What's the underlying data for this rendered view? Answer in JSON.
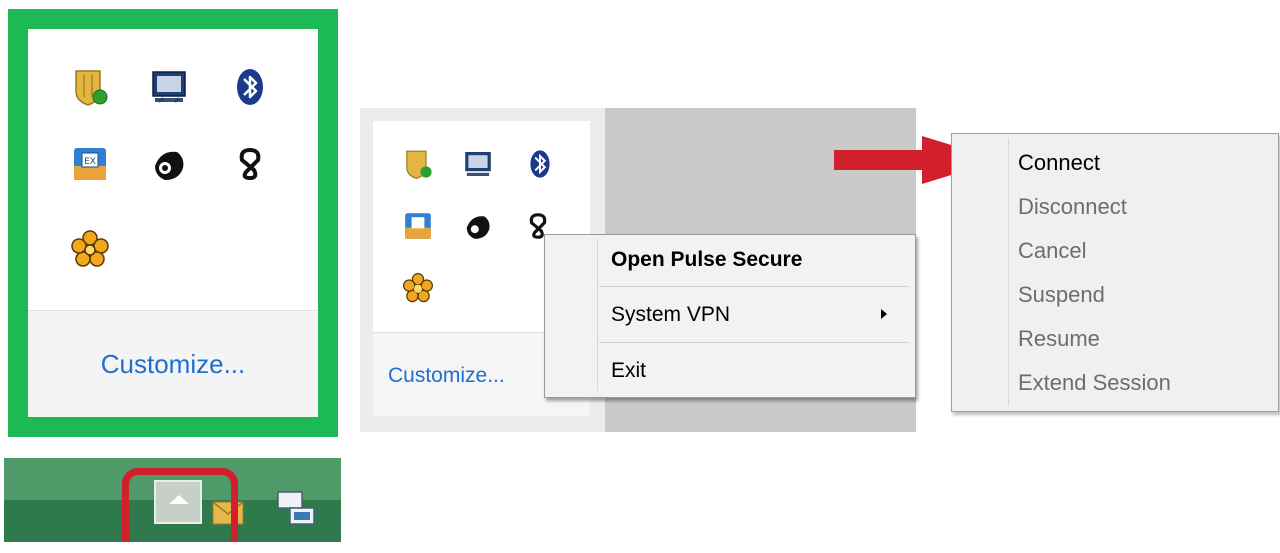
{
  "tray_panel": {
    "customize_label": "Customize...",
    "icons": [
      "shield-status-icon",
      "display-icon",
      "bluetooth-icon",
      "ime-icon",
      "ninja-icon",
      "pulse-secure-icon",
      "flower-icon"
    ]
  },
  "taskbar": {
    "show_hidden_icons_button": "show-hidden-icons-button"
  },
  "context_menu": {
    "tray_customize_label": "Customize...",
    "items": [
      {
        "label": "Open Pulse Secure"
      },
      {
        "label": "System VPN"
      },
      {
        "label": "Exit"
      }
    ]
  },
  "system_vpn_submenu": {
    "items": [
      {
        "label": "Connect",
        "enabled": true
      },
      {
        "label": "Disconnect",
        "enabled": false
      },
      {
        "label": "Cancel",
        "enabled": false
      },
      {
        "label": "Suspend",
        "enabled": false
      },
      {
        "label": "Resume",
        "enabled": false
      },
      {
        "label": "Extend Session",
        "enabled": false
      }
    ]
  },
  "colors": {
    "highlight_frame": "#1db954",
    "arrow": "#d11f2c",
    "link": "#1f6fd0"
  }
}
